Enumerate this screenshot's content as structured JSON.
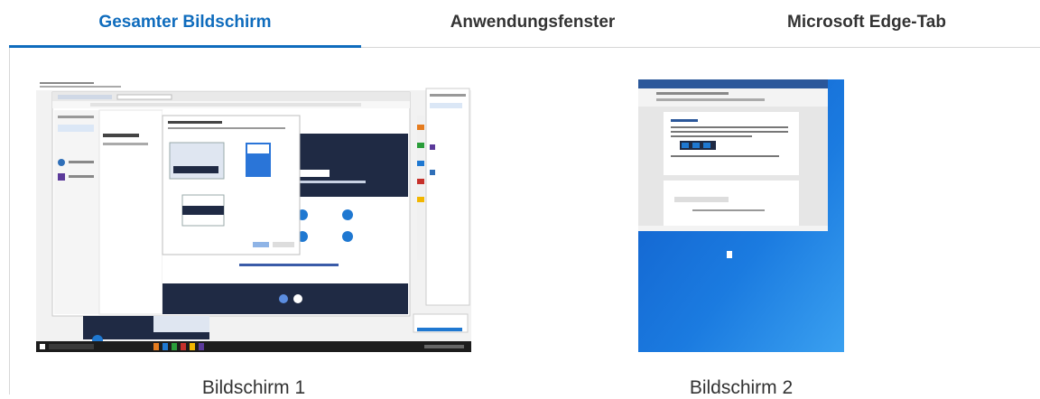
{
  "tabs": [
    {
      "label": "Gesamter Bildschirm",
      "active": true
    },
    {
      "label": "Anwendungsfenster",
      "active": false
    },
    {
      "label": "Microsoft Edge-Tab",
      "active": false
    }
  ],
  "screens": [
    {
      "label": "Bildschirm 1"
    },
    {
      "label": "Bildschirm 2"
    }
  ],
  "colors": {
    "accent": "#0f6cbd",
    "desktop_blue": "#1b6fd6",
    "dark_panel": "#1f2a44"
  }
}
